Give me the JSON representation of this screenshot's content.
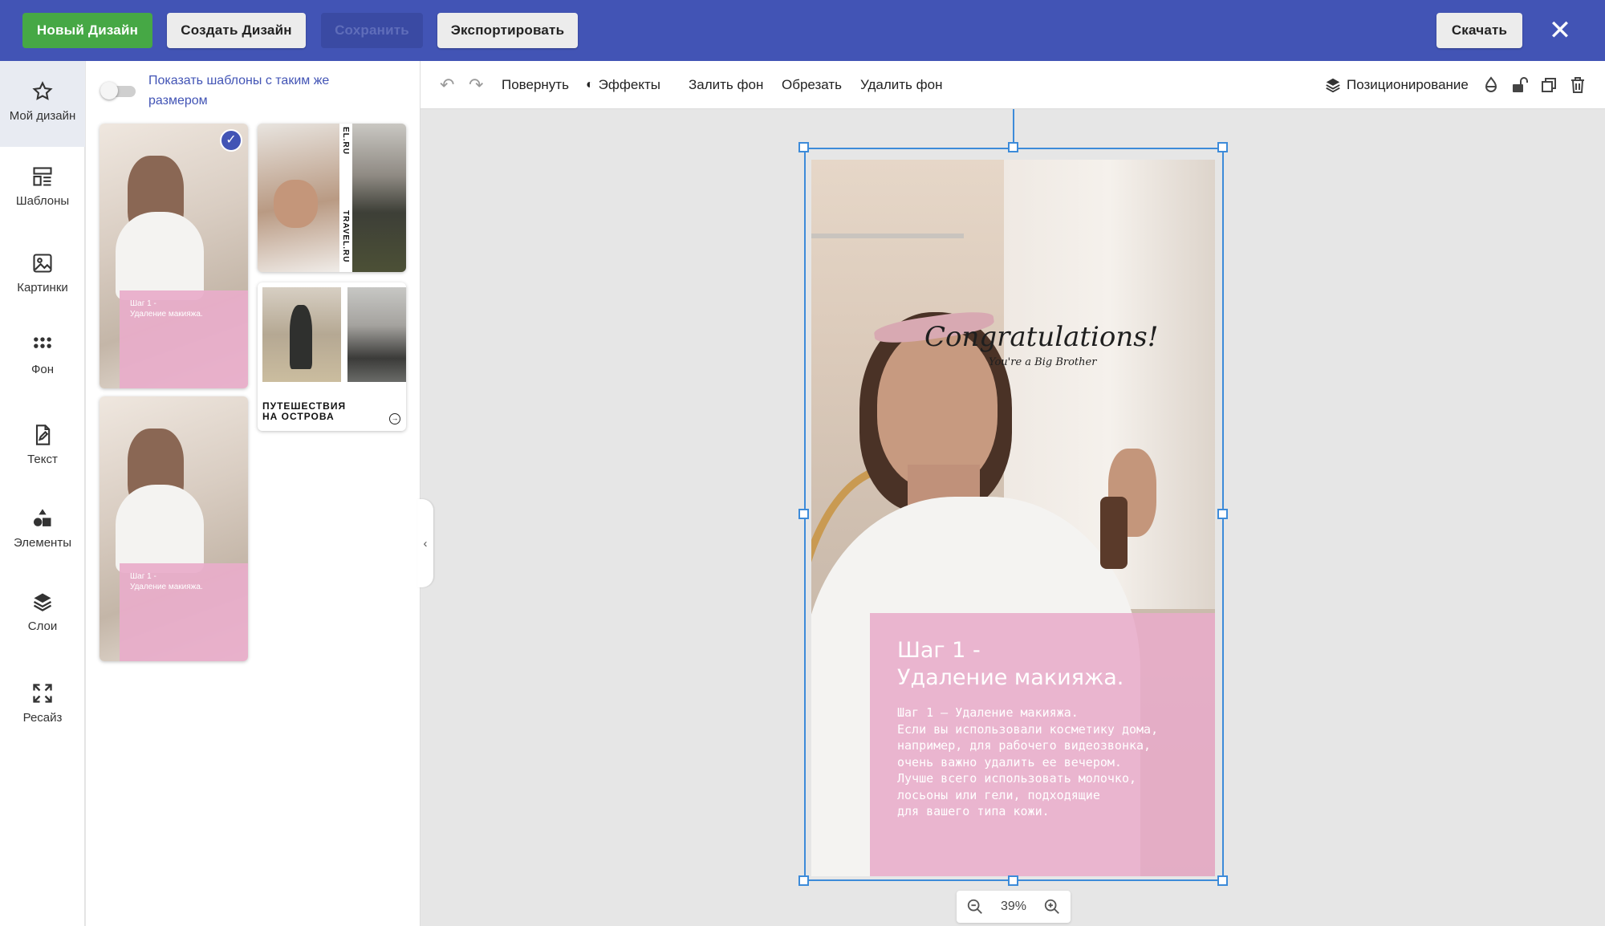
{
  "topbar": {
    "new_design": "Новый Дизайн",
    "create_design": "Создать Дизайн",
    "save": "Сохранить",
    "export": "Экспортировать",
    "download": "Скачать",
    "close_icon": "close-icon"
  },
  "sidebar": {
    "items": [
      {
        "label": "Мой дизайн",
        "icon": "star-icon"
      },
      {
        "label": "Шаблоны",
        "icon": "templates-icon"
      },
      {
        "label": "Картинки",
        "icon": "image-icon"
      },
      {
        "label": "Фон",
        "icon": "dots-grid-icon"
      },
      {
        "label": "Текст",
        "icon": "text-doc-icon"
      },
      {
        "label": "Элементы",
        "icon": "shapes-icon"
      },
      {
        "label": "Слои",
        "icon": "layers-icon"
      },
      {
        "label": "Ресайз",
        "icon": "resize-icon"
      }
    ]
  },
  "panel": {
    "toggle_label": "Показать шаблоны с таким же размером",
    "thumbnails": [
      {
        "title": "Шаг 1 -\nУдаление макияжа.",
        "selected": true
      },
      {
        "side_text_1": "EL.RU",
        "side_text_2": "TRAVEL.RU"
      },
      {
        "title": "ПУТЕШЕСТВИЯ\nНА  ОСТРОВА"
      },
      {
        "title": "Шаг 1 -\nУдаление макияжа."
      }
    ]
  },
  "toolbar": {
    "rotate": "Повернуть",
    "effects": "Эффекты",
    "fill_bg": "Залить фон",
    "crop": "Обрезать",
    "remove_bg": "Удалить фон",
    "positioning": "Позиционирование"
  },
  "design": {
    "congrats": "Congratulations!",
    "congrats_sub": "You're a Big Brother",
    "heading_line1": "Шаг 1 -",
    "heading_line2": "Удаление макияжа.",
    "body": "Шаг 1 – Удаление макияжа.\nЕсли вы использовали косметику дома,\nнапример, для рабочего видеозвонка,\nочень важно удалить ее вечером.\nЛучше всего использовать молочко,\nлосьоны или гели, подходящие\nдля вашего типа кожи.",
    "pink_color": "#e8acca"
  },
  "zoom": {
    "value": "39%"
  },
  "colors": {
    "topbar": "#4254b5",
    "green": "#46a845",
    "selection": "#3d8bd9"
  }
}
